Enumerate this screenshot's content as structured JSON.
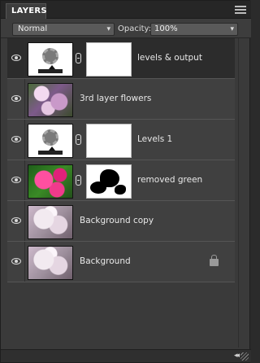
{
  "panel": {
    "tab_label": "LAYERS",
    "blend_mode": "Normal",
    "opacity_label": "Opacity:",
    "opacity_value": "100%"
  },
  "layers": [
    {
      "name": "levels & output",
      "type": "adjustment",
      "has_mask": true,
      "mask": "white",
      "selected": true,
      "visible": true,
      "locked": false
    },
    {
      "name": "3rd layer flowers",
      "type": "image",
      "thumb": "flowers",
      "has_mask": false,
      "selected": false,
      "visible": true,
      "locked": false
    },
    {
      "name": "Levels 1",
      "type": "adjustment",
      "has_mask": true,
      "mask": "white",
      "selected": false,
      "visible": true,
      "locked": false
    },
    {
      "name": "removed green",
      "type": "image",
      "thumb": "pink-flowers",
      "has_mask": true,
      "mask": "shapes",
      "selected": false,
      "visible": true,
      "locked": false
    },
    {
      "name": "Background copy",
      "type": "image",
      "thumb": "background",
      "has_mask": false,
      "selected": false,
      "visible": true,
      "locked": false
    },
    {
      "name": "Background",
      "type": "image",
      "thumb": "background",
      "has_mask": false,
      "selected": false,
      "visible": true,
      "locked": true
    }
  ],
  "icons": {
    "visibility": "eye-icon",
    "link": "chain-link-icon",
    "lock": "lock-icon",
    "panel_menu": "menu-icon",
    "collapse": "double-chevron-left-icon"
  },
  "colors": {
    "panel_bg": "#3a3a3a",
    "selected_row": "#2c2c2c",
    "row_bg": "#404040"
  }
}
